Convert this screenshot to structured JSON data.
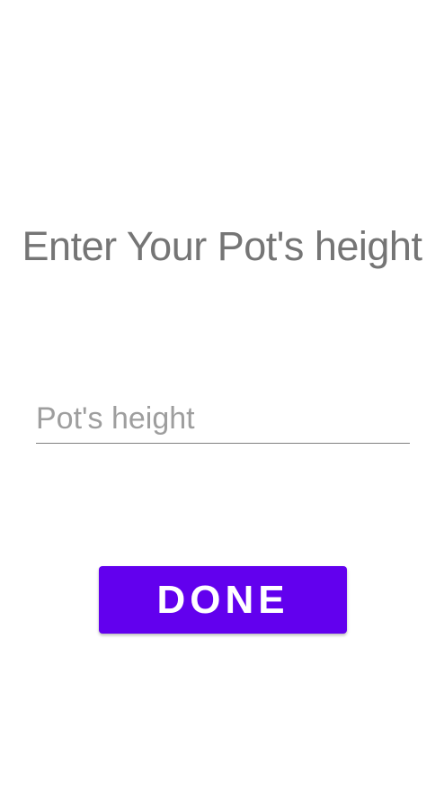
{
  "screen": {
    "title": "Enter Your Pot's height",
    "height_field": {
      "value": "",
      "placeholder": "Pot's height"
    },
    "done_button": {
      "label": "DONE"
    }
  },
  "colors": {
    "accent": "#6200ee",
    "title_text": "#757575",
    "placeholder_text": "#9e9e9e",
    "underline": "#808080",
    "background": "#ffffff"
  }
}
